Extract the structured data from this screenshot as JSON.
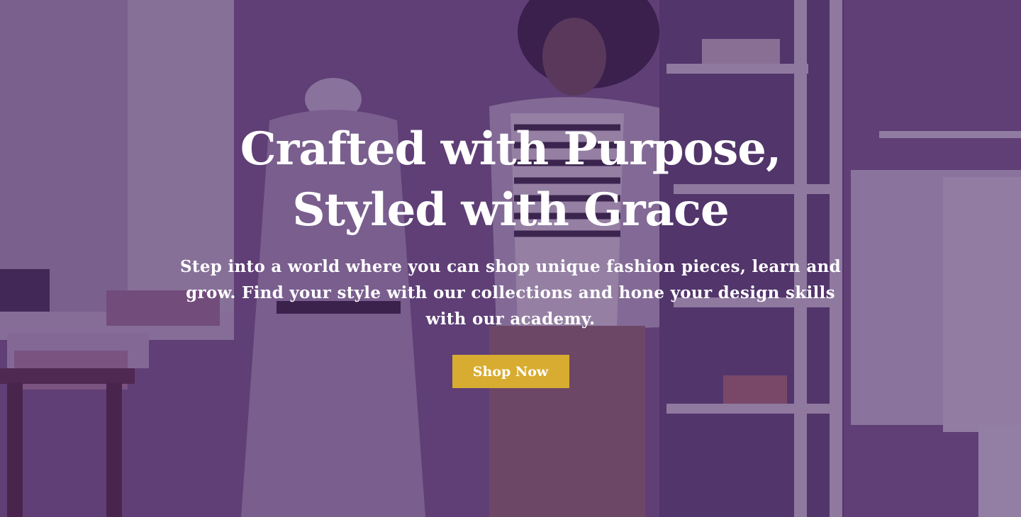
{
  "hero": {
    "headline": "Crafted with Purpose, Styled with Grace",
    "subtext": "Step into a world where you can shop unique fashion pieces, learn and grow. Find your style with our collections and hone your design skills with our academy.",
    "cta_label": "Shop Now",
    "background_image": "fashion-studio-photo",
    "overlay_color": "#4a2663",
    "cta_color": "#d8ac30"
  }
}
